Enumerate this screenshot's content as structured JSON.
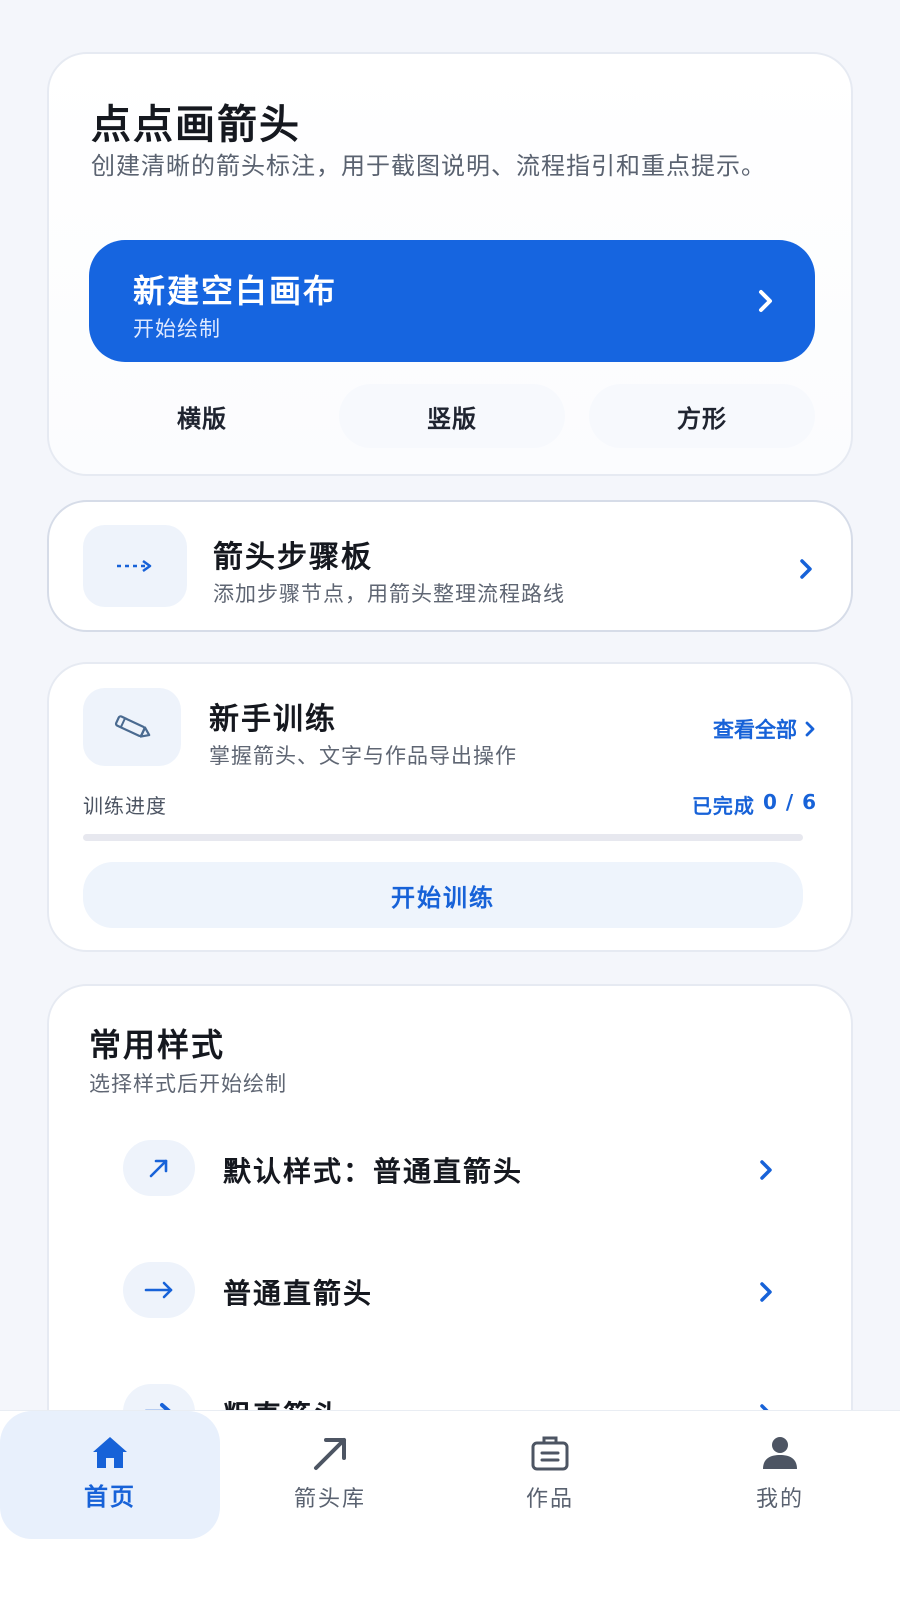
{
  "hero": {
    "title": "点点画箭头",
    "description": "创建清晰的箭头标注，用于截图说明、流程指引和重点提示。",
    "cta_title": "新建空白画布",
    "cta_subtitle": "开始绘制",
    "formats": [
      "横版",
      "竖版",
      "方形"
    ]
  },
  "step_board": {
    "title": "箭头步骤板",
    "subtitle": "添加步骤节点，用箭头整理流程路线"
  },
  "training": {
    "title": "新手训练",
    "subtitle": "掌握箭头、文字与作品导出操作",
    "view_all": "查看全部",
    "progress_label": "训练进度",
    "progress_prefix": "已完成",
    "progress_done": "0 / 6",
    "progress_fraction": 0,
    "start_button": "开始训练"
  },
  "styles": {
    "title": "常用样式",
    "subtitle": "选择样式后开始绘制",
    "items": [
      {
        "label": "默认样式：普通直箭头",
        "icon": "diagonal-arrow-icon"
      },
      {
        "label": "普通直箭头",
        "icon": "right-arrow-icon"
      },
      {
        "label": "粗直箭头",
        "icon": "thick-arrow-icon"
      }
    ]
  },
  "nav": {
    "items": [
      {
        "label": "首页",
        "icon": "home-icon"
      },
      {
        "label": "箭头库",
        "icon": "arrow-icon"
      },
      {
        "label": "作品",
        "icon": "briefcase-icon"
      },
      {
        "label": "我的",
        "icon": "user-icon"
      }
    ]
  },
  "colors": {
    "primary": "#1665e0",
    "accent_text": "#1762d8",
    "background": "#f4f6fb"
  }
}
